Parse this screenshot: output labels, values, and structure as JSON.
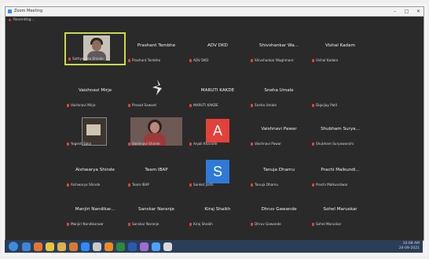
{
  "window": {
    "title": "Zoom Meeting",
    "controls": [
      "–",
      "□",
      "✕"
    ]
  },
  "meeting_bar": {
    "label": "Recording..."
  },
  "participants": [
    {
      "id": "p1",
      "center_name": "",
      "label": "Sathyendra Shinde",
      "kind": "video-face",
      "active": true
    },
    {
      "id": "p2",
      "center_name": "Prashant Tembhe",
      "label": "Prashant Tembhe",
      "kind": "name"
    },
    {
      "id": "p3",
      "center_name": "ADV DKD",
      "label": "ADV DKD",
      "kind": "name"
    },
    {
      "id": "p4",
      "center_name": "Shivshankar Wa...",
      "label": "Shivshankar Waghmare",
      "kind": "name"
    },
    {
      "id": "p5",
      "center_name": "Vishal Kadam",
      "label": "Vishal Kadam",
      "kind": "name"
    },
    {
      "id": "p6",
      "center_name": "Vaishnavi Mirje",
      "label": "Vaishnavi Mirje",
      "kind": "name"
    },
    {
      "id": "p7",
      "center_name": "",
      "label": "Prasad Sawant",
      "kind": "logo"
    },
    {
      "id": "p8",
      "center_name": "MARUTI KAKDE",
      "label": "MARUTI KAKDE",
      "kind": "name"
    },
    {
      "id": "p9",
      "center_name": "Sneha Umale",
      "label": "Sneha Umale",
      "kind": "name"
    },
    {
      "id": "p10",
      "center_name": "",
      "label": "Digvijay Patil",
      "kind": "blank"
    },
    {
      "id": "p11",
      "center_name": "",
      "label": "Yogesh Salvi",
      "kind": "video-small"
    },
    {
      "id": "p12",
      "center_name": "",
      "label": "Vaishnavi Shinde",
      "kind": "video-dark"
    },
    {
      "id": "p13",
      "center_name": "",
      "label": "Anjali Kharade",
      "kind": "letter",
      "letter": "A",
      "color": "#e3413a"
    },
    {
      "id": "p14",
      "center_name": "Vaishnavi Pawar",
      "label": "Vaishnavi Pawar",
      "kind": "name"
    },
    {
      "id": "p15",
      "center_name": "Shubham Surya...",
      "label": "Shubham Suryawanshi",
      "kind": "name"
    },
    {
      "id": "p16",
      "center_name": "Aishwarya Shinde",
      "label": "Aishwarya Shinde",
      "kind": "name"
    },
    {
      "id": "p17",
      "center_name": "Team IBAP",
      "label": "Team IBAP",
      "kind": "name"
    },
    {
      "id": "p18",
      "center_name": "",
      "label": "Sanket Joshi",
      "kind": "letter",
      "letter": "S",
      "color": "#2f79d9"
    },
    {
      "id": "p19",
      "center_name": "Tanuja Dhamu",
      "label": "Tanuja Dhamu",
      "kind": "name"
    },
    {
      "id": "p20",
      "center_name": "Prachi Malkundi...",
      "label": "Prachi Malkundiwar",
      "kind": "name"
    },
    {
      "id": "p21",
      "center_name": "Manjiri Nandikar...",
      "label": "Manjiri Nandikarwar",
      "kind": "name"
    },
    {
      "id": "p22",
      "center_name": "Sanskar Naranje",
      "label": "Sanskar Naranje",
      "kind": "name"
    },
    {
      "id": "p23",
      "center_name": "Kiraj Shaikh",
      "label": "Kiraj Shaikh",
      "kind": "name"
    },
    {
      "id": "p24",
      "center_name": "Dhruv Gawande",
      "label": "Dhruv Gawande",
      "kind": "name"
    },
    {
      "id": "p25",
      "center_name": "Sohel Maruskar",
      "label": "Sohel Maruskar",
      "kind": "name"
    }
  ],
  "taskbar": {
    "icons": [
      {
        "name": "ie-icon",
        "color": "#3f86d6"
      },
      {
        "name": "firefox-icon",
        "color": "#e8742d"
      },
      {
        "name": "chrome-icon",
        "color": "#e7c63b"
      },
      {
        "name": "folder-icon",
        "color": "#e0b04c"
      },
      {
        "name": "media-player-icon",
        "color": "#d67c2e"
      },
      {
        "name": "zoom-app-icon",
        "color": "#2d8cff"
      },
      {
        "name": "paint-icon",
        "color": "#c9c9c9"
      },
      {
        "name": "vlc-icon",
        "color": "#f08a1e"
      },
      {
        "name": "excel-icon",
        "color": "#2b8a3e"
      },
      {
        "name": "word-icon",
        "color": "#2a5bb0"
      },
      {
        "name": "photos-icon",
        "color": "#9a6fd0"
      },
      {
        "name": "zoom-active-icon",
        "color": "#4ea2ff"
      },
      {
        "name": "pen-icon",
        "color": "#d9d9d9"
      }
    ],
    "tray_time": "10:08 AM",
    "tray_date": "24-09-2021"
  }
}
